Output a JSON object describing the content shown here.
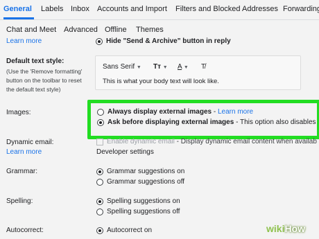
{
  "tabs_row1": [
    "General",
    "Labels",
    "Inbox",
    "Accounts and Import",
    "Filters and Blocked Addresses",
    "Forwarding"
  ],
  "tabs_row2": [
    "Chat and Meet",
    "Advanced",
    "Offline",
    "Themes"
  ],
  "top": {
    "learn_more": "Learn more",
    "send_archive_option": "Hide \"Send & Archive\" button in reply"
  },
  "default_text_style": {
    "label": "Default text style:",
    "desc_lines": [
      "(Use the 'Remove formatting'",
      "button on the toolbar to reset",
      "the default text style)"
    ],
    "font_name": "Sans Serif",
    "size_glyph": "Tт",
    "color_glyph": "A",
    "clear_glyph": "T̸",
    "preview": "This is what your body text will look like."
  },
  "images": {
    "label": "Images:",
    "option1": "Always display external images",
    "option1_sep": " - ",
    "option1_link": "Learn more",
    "option2": "Ask before displaying external images",
    "option2_suffix": " - This option also disables"
  },
  "dynamic_email": {
    "label": "Dynamic email:",
    "learn_more": "Learn more",
    "checkbox_label": "Enable dynamic email",
    "checkbox_suffix": " - Display dynamic email content when availab",
    "developer_settings": "Developer settings"
  },
  "grammar": {
    "label": "Grammar:",
    "on": "Grammar suggestions on",
    "off": "Grammar suggestions off"
  },
  "spelling": {
    "label": "Spelling:",
    "on": "Spelling suggestions on",
    "off": "Spelling suggestions off"
  },
  "autocorrect": {
    "label": "Autocorrect:",
    "on": "Autocorrect on"
  },
  "watermark": {
    "wiki": "wiki",
    "how": "How"
  },
  "colors": {
    "accent": "#1a73e8",
    "highlight": "#22dd22",
    "background": "#f3f3f3"
  }
}
